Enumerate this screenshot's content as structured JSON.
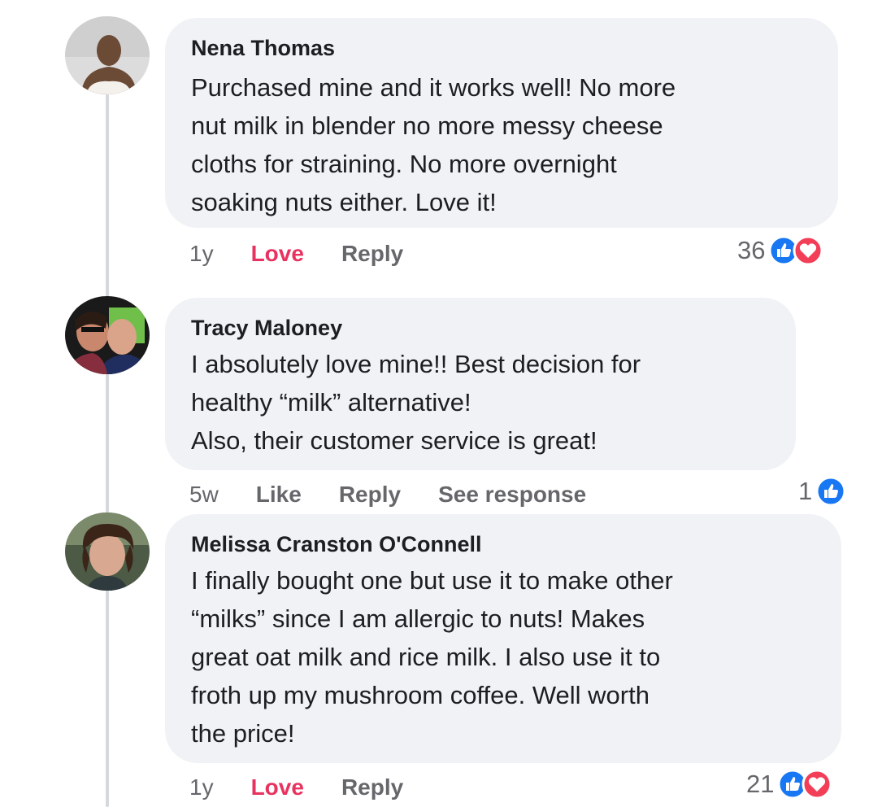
{
  "comments": [
    {
      "author": "Nena Thomas",
      "lines": [
        "Purchased mine and it works well! No more",
        "nut milk in blender no more messy cheese",
        "cloths for straining. No more overnight",
        "soaking nuts either. Love it!"
      ],
      "time": "1y",
      "reaction_action": "Love",
      "reply": "Reply",
      "reaction_count": "36",
      "reaction_icons": [
        "like-icon",
        "love-icon"
      ]
    },
    {
      "author": "Tracy Maloney",
      "lines": [
        "I absolutely love mine!! Best decision for",
        "healthy “milk” alternative!",
        "Also, their customer service is great!"
      ],
      "time": "5w",
      "reaction_action": "Like",
      "reply": "Reply",
      "see_response": "See response",
      "reaction_count": "1",
      "reaction_icons": [
        "like-icon"
      ]
    },
    {
      "author": "Melissa Cranston O'Connell",
      "lines": [
        "I finally bought one but use it to make other",
        "“milks” since I am allergic to nuts! Makes",
        "great oat milk and rice milk. I also use it to",
        "froth up my mushroom coffee. Well worth",
        "the price!"
      ],
      "time": "1y",
      "reaction_action": "Love",
      "reply": "Reply",
      "reaction_count": "21",
      "reaction_icons": [
        "like-icon",
        "love-icon"
      ]
    }
  ],
  "colors": {
    "bubble": "#f0f2f5",
    "love": "#e8325f",
    "like": "#1877f2",
    "meta": "#65676b"
  }
}
